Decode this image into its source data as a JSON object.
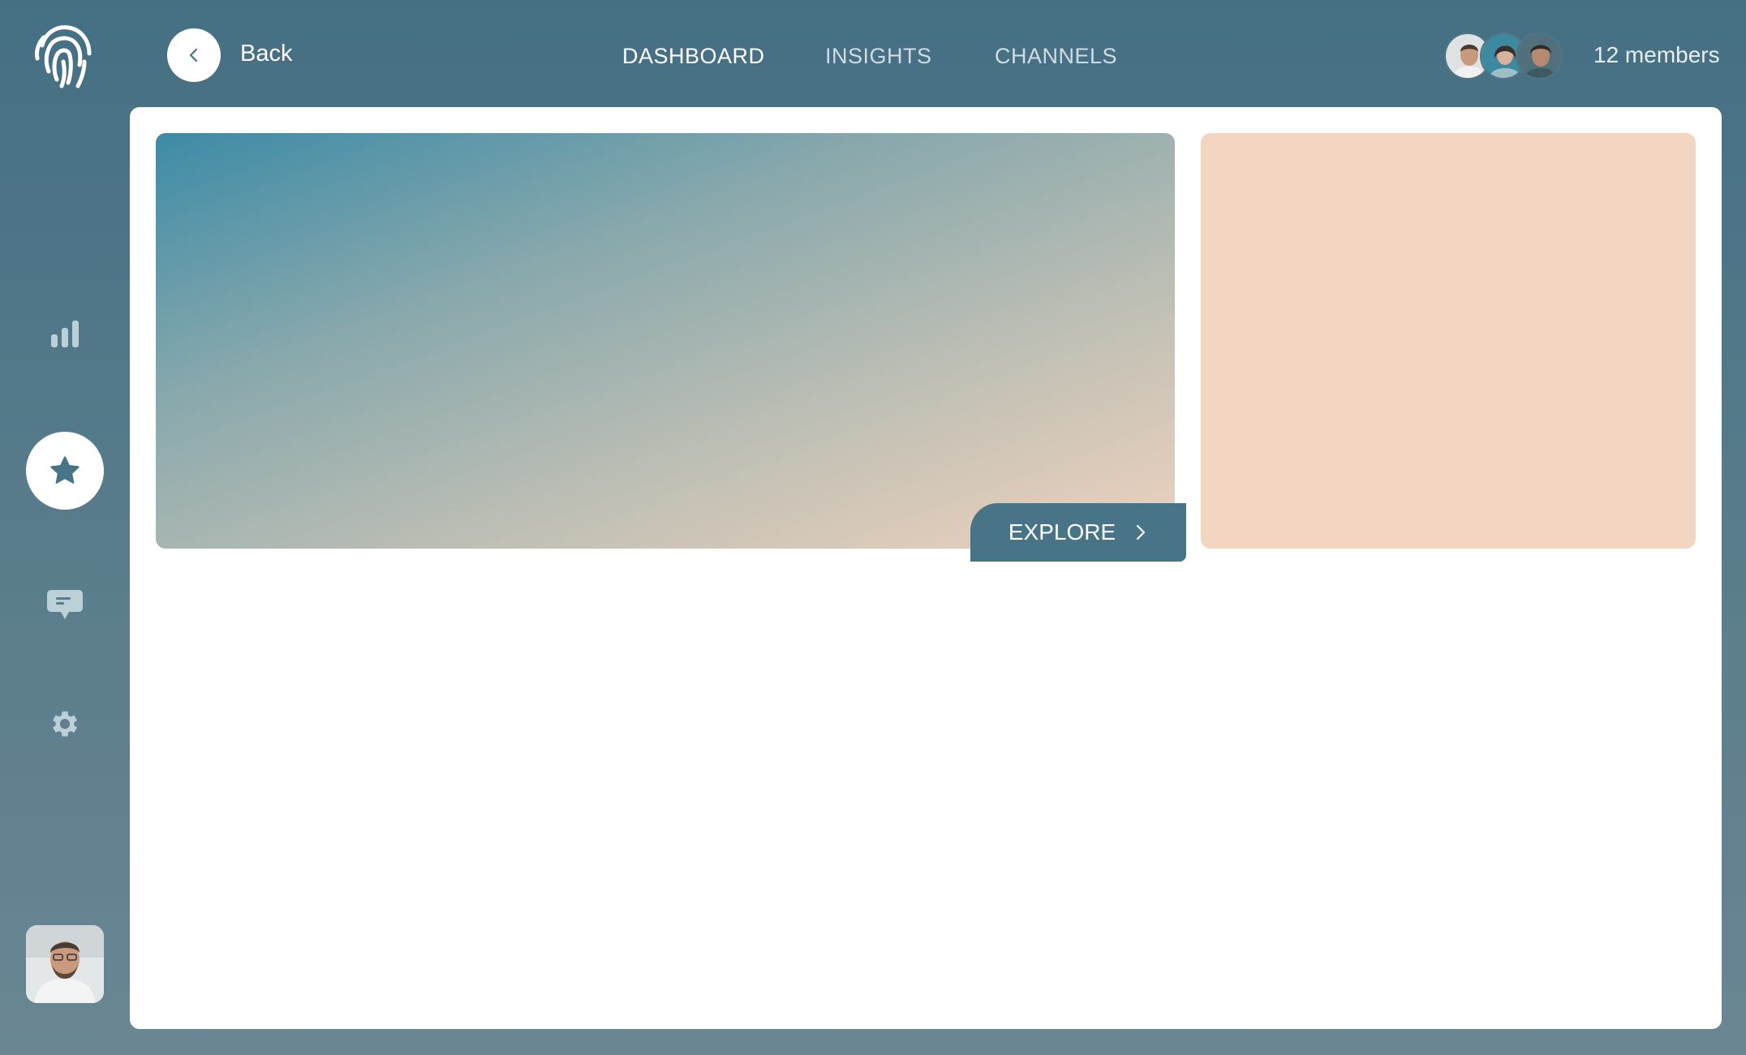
{
  "header": {
    "back_label": "Back",
    "nav": [
      {
        "label": "DASHBOARD",
        "active": true
      },
      {
        "label": "INSIGHTS",
        "active": false
      },
      {
        "label": "CHANNELS",
        "active": false
      }
    ],
    "members_label": "12 members"
  },
  "sidebar": {
    "items": [
      {
        "icon": "bar-chart-icon",
        "active": false
      },
      {
        "icon": "star-icon",
        "active": true
      },
      {
        "icon": "chat-icon",
        "active": false
      },
      {
        "icon": "gear-icon",
        "active": false
      }
    ]
  },
  "hero": {
    "cta_label": "EXPLORE"
  },
  "colors": {
    "accent": "#477486",
    "peach": "#f3d6c1",
    "background": "#4f7687"
  }
}
